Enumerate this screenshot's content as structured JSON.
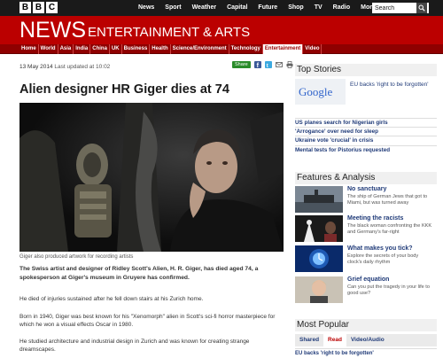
{
  "global_nav": {
    "logo_letters": [
      "B",
      "B",
      "C"
    ],
    "links": [
      "News",
      "Sport",
      "Weather",
      "Capital",
      "Future",
      "Shop",
      "TV",
      "Radio",
      "More..."
    ],
    "search_value": "Search"
  },
  "masthead": {
    "brand": "NEWS",
    "section": "ENTERTAINMENT & ARTS"
  },
  "section_nav": {
    "items": [
      "Home",
      "World",
      "Asia",
      "India",
      "China",
      "UK",
      "Business",
      "Health",
      "Science/Environment",
      "Technology",
      "Entertainment",
      "Video"
    ],
    "active": "Entertainment"
  },
  "article": {
    "date": "13 May 2014",
    "updated": "Last updated at 10:02",
    "share_label": "Share",
    "title": "Alien designer HR Giger dies at 74",
    "caption": "Giger also produced artwork for recording artists",
    "lead": "The Swiss artist and designer of Ridley Scott's Alien, H. R. Giger, has died aged 74, a spokesperson at Giger's museum in Gruyere has confirmed.",
    "paragraphs": [
      "He died of injuries sustained after he fell down stairs at his Zurich home.",
      "Born in 1940, Giger was best known for his \"Xenomorph\" alien in Scott's sci-fi horror masterpiece for which he won a visual effects Oscar in 1980.",
      "He studied architecture and industrial design in Zurich and was known for creating strange dreamscapes."
    ]
  },
  "top_stories": {
    "heading": "Top Stories",
    "thumb_text": "Google",
    "lead_story": "EU backs 'right to be forgotten'",
    "items": [
      "US planes search for Nigerian girls",
      "'Arrogance' over need for sleep",
      "Ukraine vote 'crucial' in crisis",
      "Mental tests for Pistorius requested"
    ]
  },
  "features": {
    "heading": "Features & Analysis",
    "items": [
      {
        "title": "No sanctuary",
        "summary": "The ship of German Jews that got to Miami, but was turned away"
      },
      {
        "title": "Meeting the racists",
        "summary": "The black woman confronting the KKK and Germany's far-right"
      },
      {
        "title": "What makes you tick?",
        "summary": "Explore the secrets of your body clock's daily rhythm"
      },
      {
        "title": "Grief equation",
        "summary": "Can you put the tragedy in your life to good use?"
      }
    ]
  },
  "most_popular": {
    "heading": "Most Popular",
    "tabs": [
      "Shared",
      "Read",
      "Video/Audio"
    ],
    "selected_tab": "Read",
    "first_item": "EU backs 'right to be forgotten'"
  },
  "colors": {
    "brand_red": "#bb0000",
    "link_blue": "#1f3a78",
    "share_green": "#2a8c2a"
  }
}
